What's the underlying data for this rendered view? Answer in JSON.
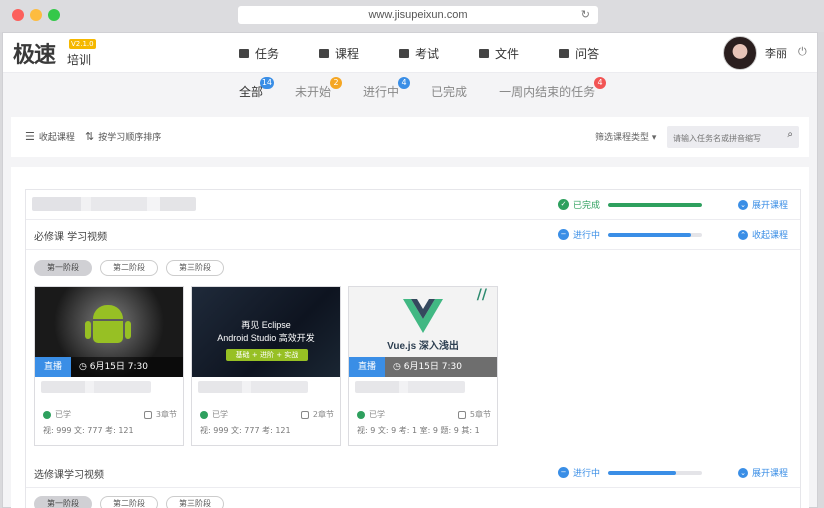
{
  "browser": {
    "url": "www.jisupeixun.com",
    "reload_icon": "reload-icon"
  },
  "header": {
    "logo": {
      "main": "极速",
      "sub": "培训",
      "version": "V2.1.0"
    },
    "nav": [
      {
        "label": "任务",
        "icon": "task-icon"
      },
      {
        "label": "课程",
        "icon": "course-icon"
      },
      {
        "label": "考试",
        "icon": "exam-icon"
      },
      {
        "label": "文件",
        "icon": "folder-icon"
      },
      {
        "label": "问答",
        "icon": "qa-icon"
      }
    ],
    "user": {
      "name": "李丽"
    },
    "power_glyph": "⏻"
  },
  "tabs": [
    {
      "label": "全部",
      "badge": "14",
      "badge_color": "#3a8ee6",
      "active": true
    },
    {
      "label": "未开始",
      "badge": "2",
      "badge_color": "#f5a623"
    },
    {
      "label": "进行中",
      "badge": "4",
      "badge_color": "#3a8ee6"
    },
    {
      "label": "已完成",
      "badge": ""
    },
    {
      "label": "一周内结束的任务",
      "badge": "4",
      "badge_color": "#f25454"
    }
  ],
  "toolbar": {
    "collapse_label": "收起课程",
    "sort_label": "按学习顺序排序",
    "filter_label": "筛选课程类型",
    "search_placeholder": "请输入任务名或拼音缩写"
  },
  "courses": [
    {
      "title": "",
      "status": "已完成",
      "status_color": "#2ea05e",
      "progress": 1.0,
      "toggle": "展开课程"
    },
    {
      "title": "必修课 学习视频",
      "status": "进行中",
      "status_color": "#3a8ee6",
      "progress": 0.88,
      "toggle": "收起课程",
      "stages": [
        "第一阶段",
        "第二阶段",
        "第三阶段"
      ],
      "cards": [
        {
          "live": "直播",
          "time": "6月15日 7:30",
          "learned": "已学",
          "chapters": "3章节",
          "stats": "视: 999  文: 777  考: 121"
        },
        {
          "headline_1": "再见 Eclipse",
          "headline_2": "Android Studio 高效开发",
          "tag": "基础 + 进阶 + 实战",
          "learned": "已学",
          "chapters": "2章节",
          "stats": "视: 999  文: 777  考: 121"
        },
        {
          "headline_1": "Vue.js 深入浅出",
          "live": "直播",
          "time": "6月15日 7:30",
          "learned": "已学",
          "chapters": "5章节",
          "stats": "视: 9  文: 9  考: 1  室: 9  题: 9  其: 1"
        }
      ]
    },
    {
      "title": "选修课学习视频",
      "status": "进行中",
      "status_color": "#3a8ee6",
      "progress": 0.72,
      "toggle": "展开课程",
      "stages": [
        "第一阶段",
        "第二阶段",
        "第三阶段"
      ]
    }
  ]
}
